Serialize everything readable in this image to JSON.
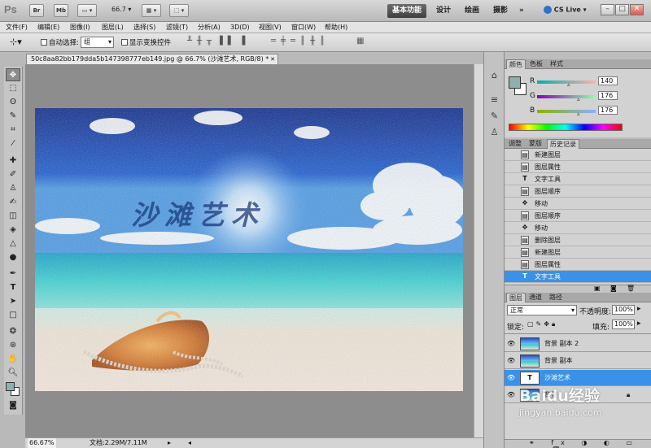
{
  "titlebar": {
    "logo": "Ps",
    "bridge": "Br",
    "minibridge": "Mb",
    "zoom": "66.7",
    "workspaces": [
      "基本功能",
      "设计",
      "绘画",
      "摄影"
    ],
    "more": "»",
    "cslive": "CS Live",
    "win_buttons": [
      "–",
      "□",
      "✕"
    ]
  },
  "menu": [
    "文件(F)",
    "编辑(E)",
    "图像(I)",
    "图层(L)",
    "选择(S)",
    "滤镜(T)",
    "分析(A)",
    "3D(D)",
    "视图(V)",
    "窗口(W)",
    "帮助(H)"
  ],
  "options": {
    "auto_select_label": "自动选择:",
    "auto_select_value": "组",
    "show_transform_label": "显示变换控件"
  },
  "document": {
    "tab_title": "50c8aa82bb179dda5b147398777eb149.jpg @ 66.7% (沙滩艺术, RGB/8) *",
    "tab_close": "✕",
    "canvas_text": "沙滩艺术"
  },
  "status": {
    "zoom": "66.67%",
    "doc": "文档:2.29M/7.11M"
  },
  "color_panel": {
    "tabs": [
      "颜色",
      "色板",
      "样式"
    ],
    "channels": [
      {
        "label": "R",
        "value": "140"
      },
      {
        "label": "G",
        "value": "176"
      },
      {
        "label": "B",
        "value": "176"
      }
    ],
    "fg": "#8cb0b0"
  },
  "history_panel": {
    "tabs": [
      "调整",
      "蒙版",
      "历史记录"
    ],
    "items": [
      {
        "icon": "doc",
        "label": "新建图层"
      },
      {
        "icon": "doc",
        "label": "图层属性"
      },
      {
        "icon": "T",
        "label": "文字工具"
      },
      {
        "icon": "doc",
        "label": "图层顺序"
      },
      {
        "icon": "move",
        "label": "移动"
      },
      {
        "icon": "doc",
        "label": "图层顺序"
      },
      {
        "icon": "move",
        "label": "移动"
      },
      {
        "icon": "doc",
        "label": "删除图层"
      },
      {
        "icon": "doc",
        "label": "新建图层"
      },
      {
        "icon": "doc",
        "label": "图层属性"
      },
      {
        "icon": "T",
        "label": "文字工具"
      }
    ]
  },
  "layers_panel": {
    "tabs": [
      "图层",
      "通道",
      "路径"
    ],
    "blend_mode": "正常",
    "opacity_label": "不透明度:",
    "opacity": "100%",
    "lock_label": "锁定:",
    "fill_label": "填充:",
    "fill": "100%",
    "layers": [
      {
        "name": "背景 副本 2",
        "type": "image"
      },
      {
        "name": "背景 副本",
        "type": "image"
      },
      {
        "name": "沙滩艺术",
        "type": "text"
      },
      {
        "name": "背景",
        "type": "image"
      }
    ]
  },
  "watermark": {
    "brand": "Baidu经验",
    "url": "jingyan.baidu.com"
  },
  "colors": {
    "accent": "#3a92e8",
    "workspace_active": "#4a4a4a"
  }
}
